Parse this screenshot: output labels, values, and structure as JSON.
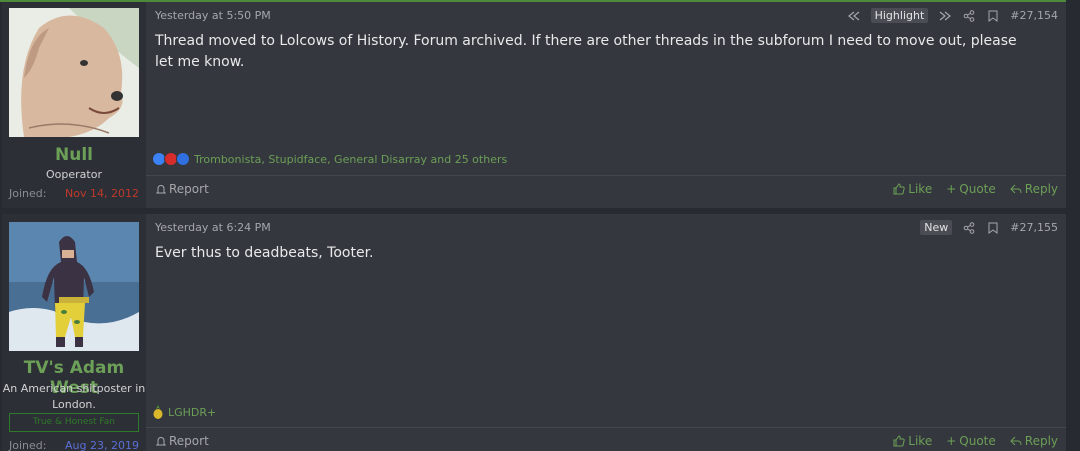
{
  "posts": [
    {
      "user": {
        "name": "Null",
        "title": "Ooperator",
        "joined_label": "Joined:",
        "joined_date": "Nov 14, 2012",
        "joined_color": "#c0392b"
      },
      "date": "Yesterday at 5:50 PM",
      "highlight_label": "Highlight",
      "number": "#27,154",
      "body": "Thread moved to Lolcows of History. Forum archived. If there are other threads in the subforum I need to move out, please let me know.",
      "reactions": "Trombonista, Stupidface, General Disarray and 25 others",
      "report_label": "Report",
      "like_label": "Like",
      "quote_label": "Quote",
      "reply_label": "Reply"
    },
    {
      "user": {
        "name": "TV's Adam West",
        "title": "An American shitposter in London.",
        "badge": "True & Honest Fan",
        "joined_label": "Joined:",
        "joined_date": "Aug 23, 2019",
        "joined_color": "#5b6fd6"
      },
      "date": "Yesterday at 6:24 PM",
      "new_label": "New",
      "number": "#27,155",
      "body": "Ever thus to deadbeats, Tooter.",
      "reactions": "LGHDR+",
      "report_label": "Report",
      "like_label": "Like",
      "quote_label": "Quote",
      "reply_label": "Reply"
    }
  ],
  "icons": [
    "rewind-icon",
    "fast-forward-icon",
    "share-icon",
    "bookmark-icon",
    "bell-icon",
    "thumbs-up-icon",
    "plus-icon",
    "reply-arrow-icon"
  ],
  "colors": {
    "accent": "#6c9f57",
    "background": "#272a30",
    "post_bg": "#34373d"
  }
}
